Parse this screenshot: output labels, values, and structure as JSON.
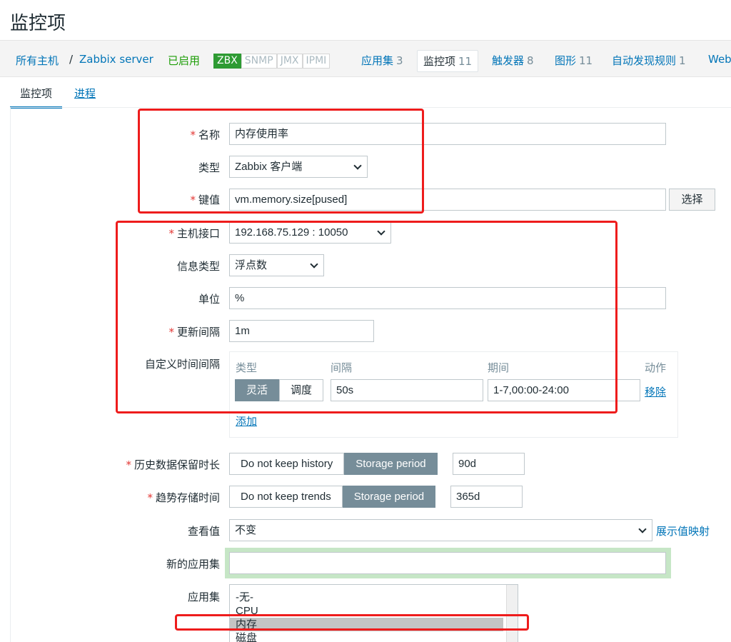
{
  "page_title": "监控项",
  "nav": {
    "all_hosts": "所有主机",
    "separator": "/",
    "host": "Zabbix server",
    "status": "已启用",
    "badges": [
      "ZBX",
      "SNMP",
      "JMX",
      "IPMI"
    ],
    "tabs": [
      {
        "label": "应用集",
        "count": "3"
      },
      {
        "label": "监控项",
        "count": "11"
      },
      {
        "label": "触发器",
        "count": "8"
      },
      {
        "label": "图形",
        "count": "11"
      },
      {
        "label": "自动发现规则",
        "count": "1"
      },
      {
        "label": "Web",
        "count": ""
      }
    ]
  },
  "subtabs": {
    "item": "监控项",
    "process": "进程"
  },
  "form": {
    "name_label": "名称",
    "name_value": "内存使用率",
    "type_label": "类型",
    "type_value": "Zabbix 客户端",
    "key_label": "键值",
    "key_value": "vm.memory.size[pused]",
    "key_button": "选择",
    "interface_label": "主机接口",
    "interface_value": "192.168.75.129 : 10050",
    "info_type_label": "信息类型",
    "info_type_value": "浮点数",
    "units_label": "单位",
    "units_value": "%",
    "interval_label": "更新间隔",
    "interval_value": "1m",
    "custom_label": "自定义时间间隔",
    "custom": {
      "col_type": "类型",
      "col_interval": "间隔",
      "col_period": "期间",
      "col_action": "动作",
      "mode_flexible": "灵活",
      "mode_scheduling": "调度",
      "interval": "50s",
      "period": "1-7,00:00-24:00",
      "remove": "移除",
      "add": "添加"
    },
    "history_label": "历史数据保留时长",
    "history_opt1": "Do not keep history",
    "history_opt2": "Storage period",
    "history_value": "90d",
    "trends_label": "趋势存储时间",
    "trends_opt1": "Do not keep trends",
    "trends_opt2": "Storage period",
    "trends_value": "365d",
    "valuemap_label": "查看值",
    "valuemap_value": "不变",
    "valuemap_link": "展示值映射",
    "new_app_label": "新的应用集",
    "new_app_value": "",
    "apps_label": "应用集",
    "apps": [
      "-无-",
      "CPU",
      "内存",
      "磁盘"
    ]
  },
  "colors": {
    "link": "#0275b8",
    "enabled": "#1c9d06",
    "required": "#e33734",
    "annotation": "#ee1c1c",
    "selected_segment": "#768d99"
  }
}
